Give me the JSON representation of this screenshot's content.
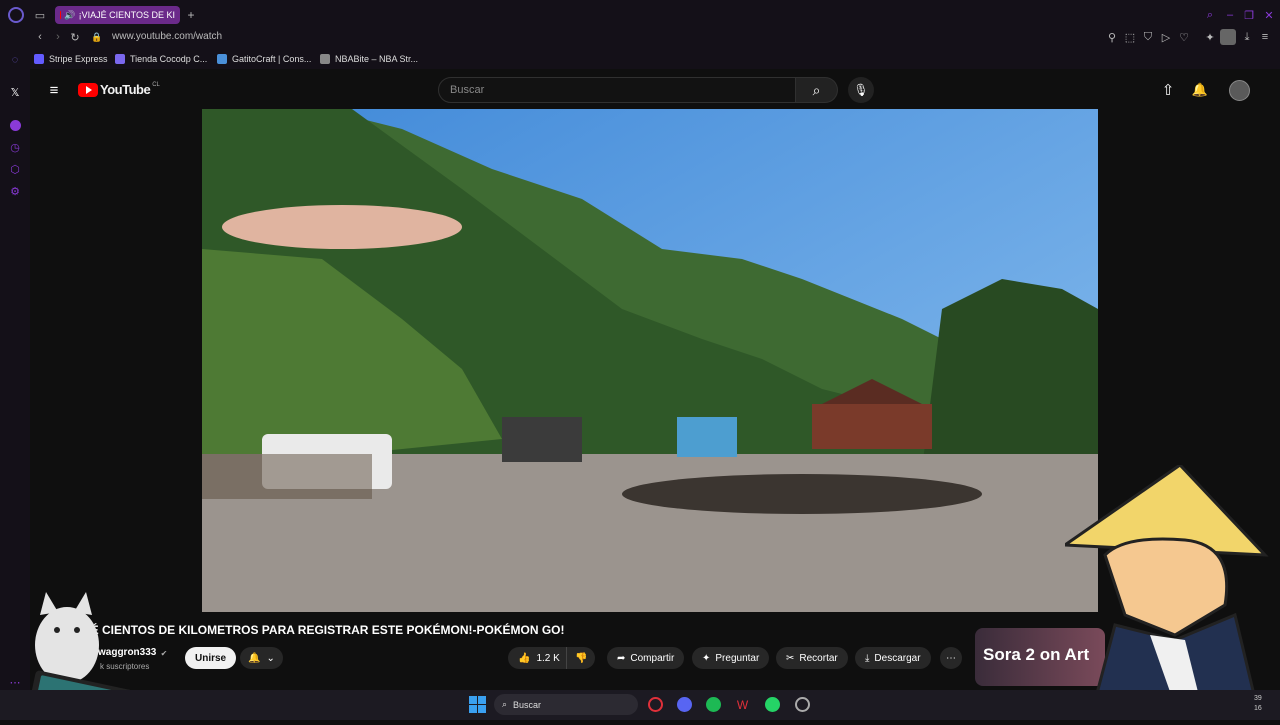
{
  "browser": {
    "tab_title": "¡VIAJÉ CIENTOS DE KI",
    "new_tab": "+",
    "url": "www.youtube.com/watch",
    "bookmarks": [
      {
        "label": "Stripe Express",
        "color": "#635bff"
      },
      {
        "label": "Tienda Cocodp C...",
        "color": "#7b68ee"
      },
      {
        "label": "GatitoCraft | Cons...",
        "color": "#4a90d9"
      },
      {
        "label": "NBABite – NBA Str...",
        "color": "#888888"
      }
    ]
  },
  "youtube": {
    "logo_text": "YouTube",
    "region": "CL",
    "search_placeholder": "Buscar"
  },
  "video": {
    "title": "JÉ CIENTOS DE KILOMETROS PARA REGISTRAR ESTE POKÉMON!-POKÉMON GO!",
    "channel": "waggron333",
    "subscribers": "k suscriptores",
    "join_label": "Unirse",
    "likes": "1.2 K",
    "share_label": "Compartir",
    "ask_label": "Preguntar",
    "clip_label": "Recortar",
    "download_label": "Descargar"
  },
  "promo": {
    "text": "Sora 2 on Art"
  },
  "taskbar": {
    "search_label": "Buscar",
    "clock_top": "39",
    "clock_bottom": "16"
  },
  "colors": {
    "accent_tab": "#6b2a8a",
    "yt_red": "#ff0000",
    "bg": "#0f0f0f",
    "sidebar_icon": "#8a3ad8"
  }
}
